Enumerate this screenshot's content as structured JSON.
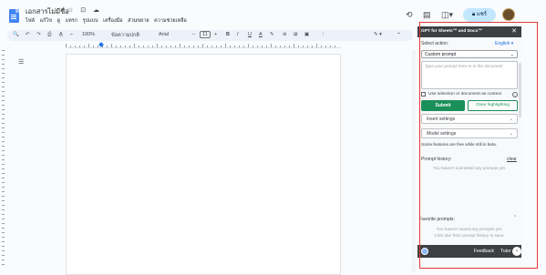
{
  "document": {
    "title": "เอกสารไม่มีชื่อ",
    "title_icons": "☆ ⊡ ☁",
    "menu": [
      "ไฟล์",
      "แก้ไข",
      "ดู",
      "แทรก",
      "รูปแบบ",
      "เครื่องมือ",
      "ส่วนขยาย",
      "ความช่วยเหลือ"
    ]
  },
  "header": {
    "share_label": "แชร์",
    "icons": [
      "history-icon",
      "comment-icon",
      "meet-icon",
      "lock-icon",
      "avatar"
    ]
  },
  "toolbar": {
    "zoom": "100%",
    "style": "ข้อความปกติ",
    "font": "Arial",
    "font_size": "11",
    "buttons": [
      "search-icon",
      "undo-icon",
      "redo-icon",
      "print-icon",
      "spellcheck-icon",
      "paint-format-icon",
      "bold-icon",
      "italic-icon",
      "underline-icon",
      "text-color-icon",
      "highlight-icon",
      "link-icon",
      "comment-icon",
      "image-icon",
      "more-icon",
      "edit-mode-icon",
      "collapse-icon"
    ],
    "glyphs": {
      "search": "🔍",
      "undo": "↶",
      "redo": "↷",
      "print": "⎙",
      "spell": "A̲",
      "paint": "⌐",
      "minus": "−",
      "plus": "+",
      "bold": "B",
      "italic": "I",
      "underline": "U",
      "color": "A",
      "highlight": "✎",
      "link": "⊖",
      "comment": "⊞",
      "image": "▣",
      "more": "⋮",
      "edit": "✎ ▾",
      "collapse": "⌃"
    }
  },
  "panel": {
    "title": "GPT for Sheets™ and Docs™",
    "close": "✕",
    "select_action_label": "Select action:",
    "language": "English ▾",
    "action_value": "Custom prompt",
    "prompt_placeholder": "Type your prompt here or in the document",
    "use_selection_label": "Use selection or document as context",
    "info": "i",
    "submit_label": "Submit",
    "clear_highlighting_label": "Clear highlighting",
    "insert_settings_label": "Insert settings",
    "model_settings_label": "Model settings",
    "beta_note": "Some features are free while still in beta.",
    "prompt_history_label": "Prompt history:",
    "clear_label": "clear",
    "history_empty": "You haven't submitted any prompts yet.",
    "favorite_label": "Favorite prompts:",
    "favorite_empty_1": "You haven't saved any prompts yet.",
    "favorite_empty_2": "Click star from prompt history to save.",
    "feedback_label": "Feedback",
    "tutorials_label": "Tutor",
    "foot_btn": "‹",
    "chevron": "⌄",
    "chevron_up": "⌃"
  },
  "colors": {
    "accent": "#1b8f5a",
    "panel_header": "#3c4043",
    "highlight_box": "#e53935",
    "share": "#c2e7ff"
  }
}
